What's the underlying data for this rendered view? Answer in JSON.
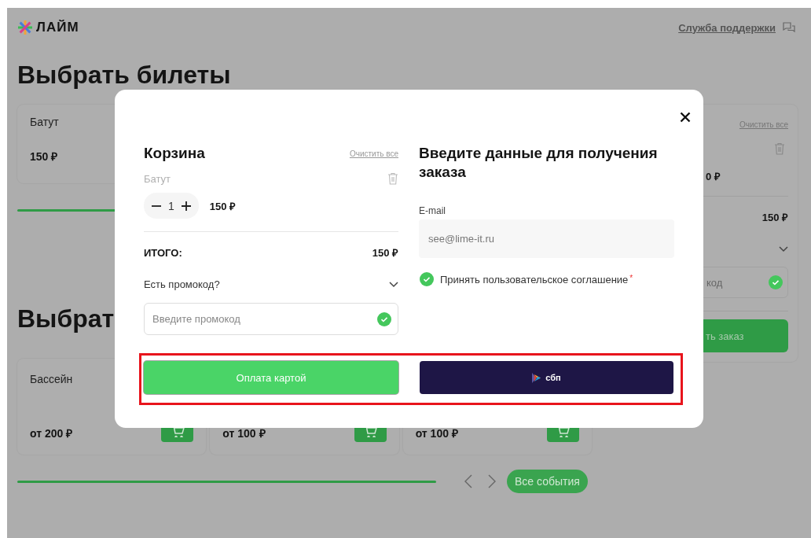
{
  "page": {
    "logo": "ЛАЙМ",
    "support_link": "Служба поддержки",
    "heading": "Выбрать билеты",
    "heading_2": "Выбрат"
  },
  "top_card": {
    "title": "Батут",
    "price": "150 ₽"
  },
  "side_cart": {
    "clear_all": "Очистить все",
    "item_price": "0 ₽",
    "total": "150 ₽",
    "promo_placeholder": "код",
    "promo_valid": true,
    "order_button": "ть заказ"
  },
  "events": [
    {
      "title": "Бассейн",
      "price": "от 200 ₽"
    },
    {
      "price": "от 100 ₽"
    },
    {
      "price": "от 100 ₽"
    }
  ],
  "all_events_button": "Все события",
  "modal": {
    "cart": {
      "title": "Корзина",
      "clear_all": "Очистить все",
      "items": [
        {
          "name": "Батут",
          "quantity": "1",
          "price": "150 ₽"
        }
      ],
      "total_label": "ИТОГО:",
      "total": "150 ₽",
      "promo_toggle": "Есть промокод?",
      "promo_expanded": true,
      "promo_placeholder": "Введите промокод",
      "promo_valid": true
    },
    "form": {
      "title": "Введите данные для получения заказа",
      "email_label": "E-mail",
      "email_value": "see@lime-it.ru",
      "agreement": "Принять пользовательское соглашение",
      "agreement_checked": true,
      "required_mark": "*"
    },
    "buttons": [
      {
        "kind": "card",
        "label": "Оплата картой"
      },
      {
        "kind": "sbp",
        "label": "сбп"
      }
    ]
  }
}
